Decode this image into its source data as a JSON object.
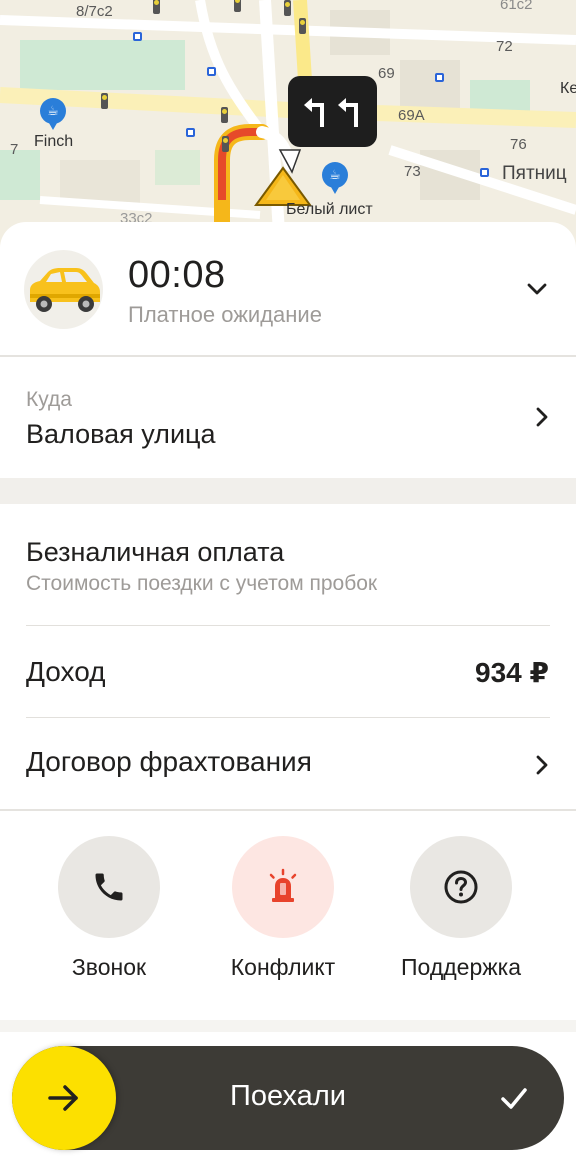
{
  "map": {
    "labels": {
      "house_8_7c2": "8/7с2",
      "house_61c2": "61с2",
      "house_72": "72",
      "house_69": "69",
      "house_69a": "69А",
      "house_76": "76",
      "house_73": "73",
      "house_7": "7",
      "house_33c2": "33с2",
      "street_pyatnits": "Пятниц",
      "place_finch": "Finch",
      "place_belyi_list": "Белый лист",
      "place_ke": "Ке"
    },
    "maneuver_icon": "turn-left-double-icon"
  },
  "status": {
    "timer": "00:08",
    "subtitle": "Платное ожидание"
  },
  "destination": {
    "caption": "Куда",
    "value": "Валовая улица"
  },
  "payment": {
    "title": "Безналичная оплата",
    "subtitle": "Стоимость поездки с учетом пробок"
  },
  "income": {
    "label": "Доход",
    "value": "934 ₽"
  },
  "contract": {
    "label": "Договор фрахтования"
  },
  "actions": [
    {
      "label": "Звонок",
      "icon": "phone-icon"
    },
    {
      "label": "Конфликт",
      "icon": "alarm-siren-icon"
    },
    {
      "label": "Поддержка",
      "icon": "help-icon"
    }
  ],
  "slider": {
    "label": "Поехали"
  },
  "colors": {
    "accent_yellow": "#fce000",
    "slider_bg": "#3d3b36",
    "conflict_red": "#e8432c",
    "route_orange": "#f5a623",
    "route_red": "#e64a2a"
  }
}
